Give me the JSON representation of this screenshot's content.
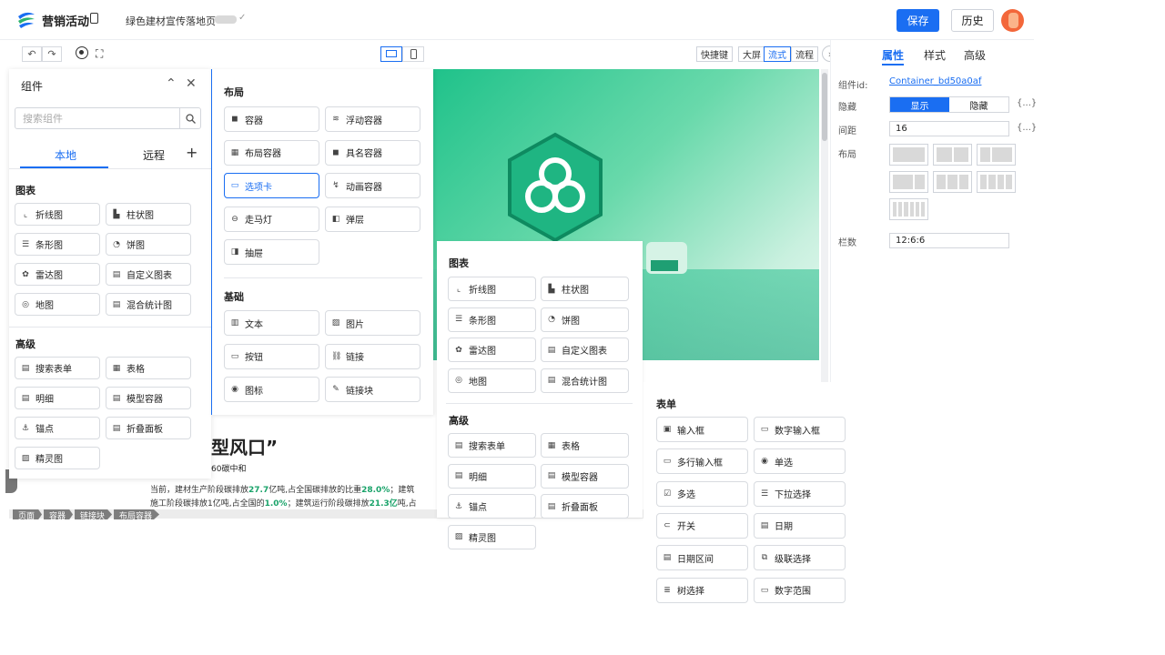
{
  "header": {
    "app_title": "营销活动",
    "page_title": "绿色建材宣传落地页",
    "save_label": "保存",
    "history_label": "历史"
  },
  "toolbar": {
    "shortcut_label": "快捷键",
    "big_screen_label": "大屏",
    "flow_layout_label": "流式",
    "process_label": "流程"
  },
  "props": {
    "tabs": [
      "属性",
      "样式",
      "高级"
    ],
    "component_id_label": "组件id:",
    "component_id": "Container_bd50a0af",
    "hidden_label": "隐藏",
    "show_option": "显示",
    "hide_option": "隐藏",
    "brace": "{...}",
    "spacing_label": "间距",
    "spacing_value": "16",
    "layout_label": "布局",
    "columns_label": "栏数",
    "columns_value": "12:6:6"
  },
  "left_panel": {
    "title": "组件",
    "search_placeholder": "搜索组件",
    "tab_local": "本地",
    "tab_remote": "远程",
    "add": "+",
    "chart_title": "图表",
    "advanced_title": "高级",
    "charts": [
      "折线图",
      "柱状图",
      "条形图",
      "饼图",
      "雷达图",
      "自定义图表",
      "地图",
      "混合统计图"
    ],
    "advanced": [
      "搜索表单",
      "表格",
      "明细",
      "模型容器",
      "锚点",
      "折叠面板",
      "精灵图"
    ]
  },
  "popup_layout": {
    "layout_title": "布局",
    "layout_items": [
      "容器",
      "浮动容器",
      "布局容器",
      "具名容器",
      "选项卡",
      "动画容器",
      "走马灯",
      "弹层",
      "抽屉"
    ],
    "basic_title": "基础",
    "basic_items": [
      "文本",
      "图片",
      "按钮",
      "链接",
      "图标",
      "链接块"
    ]
  },
  "popup_charts": {
    "chart_title": "图表",
    "charts": [
      "折线图",
      "柱状图",
      "条形图",
      "饼图",
      "雷达图",
      "自定义图表",
      "地图",
      "混合统计图"
    ],
    "advanced_title": "高级",
    "advanced": [
      "搜索表单",
      "表格",
      "明细",
      "模型容器",
      "锚点",
      "折叠面板",
      "精灵图"
    ]
  },
  "popup_form": {
    "form_title": "表单",
    "items": [
      "输入框",
      "数字输入框",
      "多行输入框",
      "单选",
      "多选",
      "下拉选择",
      "开关",
      "日期",
      "日期区间",
      "级联选择",
      "树选择",
      "数字范围"
    ]
  },
  "canvas": {
    "heading": "型风口”",
    "sub": "60碳中和",
    "para_a": "当前，建材生产阶段碳排放",
    "para_b": "27.7",
    "para_c": "亿吨,占全国碳排放的比重",
    "para_d": "28.0%",
    "para_e": "；建筑",
    "para_f": "施工阶段碳排放1亿吨,占全国的",
    "para_g": "1.0%",
    "para_h": "；建筑运行阶段碳排放",
    "para_i": "21.3亿",
    "para_j": "吨,占"
  },
  "breadcrumb": [
    "页面",
    "容器",
    "链接块",
    "布局容器"
  ],
  "colors": {
    "accent": "#1a6ef2",
    "highlight": "#1aa36a"
  }
}
